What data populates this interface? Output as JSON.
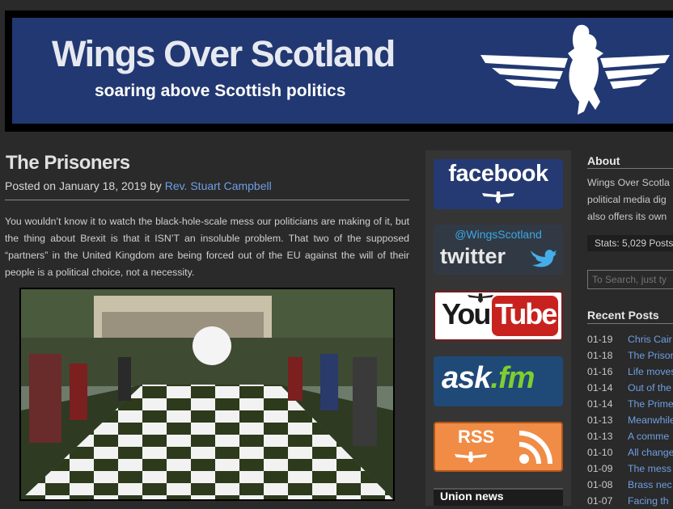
{
  "header": {
    "site_title": "Wings Over Scotland",
    "tagline": "soaring above Scottish politics"
  },
  "post": {
    "title": "The Prisoners",
    "meta_prefix": "Posted on January 18, 2019 by ",
    "author": "Rev. Stuart Campbell",
    "body": "You wouldn’t know it to watch the black-hole-scale mess our politicians are making of it, but the thing about Brexit is that it ISN’T an insoluble problem. That two of the supposed “partners” in the United Kingdom are being forced out of the EU against the will of their people is a political choice, not a necessity."
  },
  "social": {
    "facebook": "facebook",
    "twitter_handle": "@WingsScotland",
    "twitter": "twitter",
    "youtube_you": "You",
    "youtube_tube": "Tube",
    "ask": "ask",
    "ask_suffix": ".fm",
    "rss": "RSS",
    "union_news": "Union news"
  },
  "sidebar": {
    "about_heading": "About",
    "about_lines": [
      "Wings Over Scotla",
      "political media dig",
      "also offers its own"
    ],
    "stats": "Stats: 5,029 Posts",
    "search_placeholder": "To Search, just ty",
    "recent_heading": "Recent Posts",
    "recent_posts": [
      {
        "date": "01-19",
        "title": "Chris Cair"
      },
      {
        "date": "01-18",
        "title": "The Prison"
      },
      {
        "date": "01-16",
        "title": "Life moves"
      },
      {
        "date": "01-14",
        "title": "Out of the"
      },
      {
        "date": "01-14",
        "title": "The Prime"
      },
      {
        "date": "01-13",
        "title": "Meanwhile"
      },
      {
        "date": "01-13",
        "title": "A comme"
      },
      {
        "date": "01-10",
        "title": "All change"
      },
      {
        "date": "01-09",
        "title": "The mess"
      },
      {
        "date": "01-08",
        "title": "Brass nec"
      },
      {
        "date": "01-07",
        "title": "Facing th"
      }
    ]
  },
  "colors": {
    "banner_blue": "#223872",
    "link_blue": "#6e9fe4",
    "background": "#2a2a2a"
  }
}
